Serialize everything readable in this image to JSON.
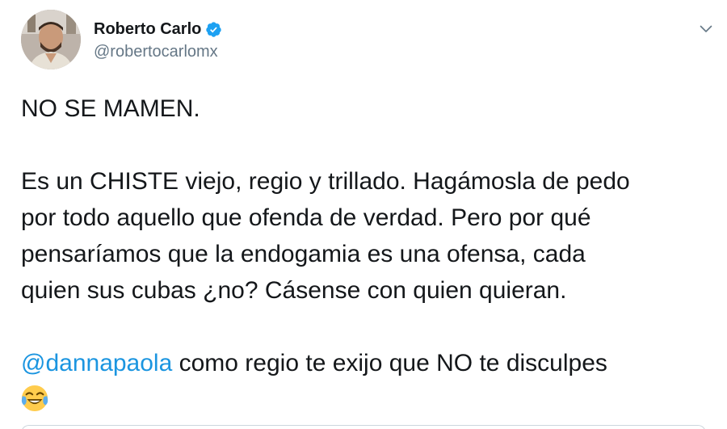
{
  "author": {
    "display_name": "Roberto Carlo",
    "handle": "@robertocarlomx",
    "verified": true,
    "avatar_icon": "profile-photo"
  },
  "menu": {
    "caret_icon": "chevron-down-icon"
  },
  "tweet": {
    "line1": "NO SE MAMEN.",
    "paragraph2": [
      "Es un CHISTE viejo, regio y trillado. Hagámosla de pedo",
      "por todo aquello que ofenda de verdad. Pero por qué",
      "pensaríamos que la endogamia es una ofensa, cada",
      "quien sus cubas ¿no? Cásense con quien quieran."
    ],
    "mention": "@dannapaola",
    "mention_rest": " como regio te exijo que NO te disculpes",
    "emoji": "face-with-tears-of-joy"
  },
  "colors": {
    "text": "#14171a",
    "secondary": "#657786",
    "link": "#1b95e0",
    "verified": "#1da1f2"
  }
}
